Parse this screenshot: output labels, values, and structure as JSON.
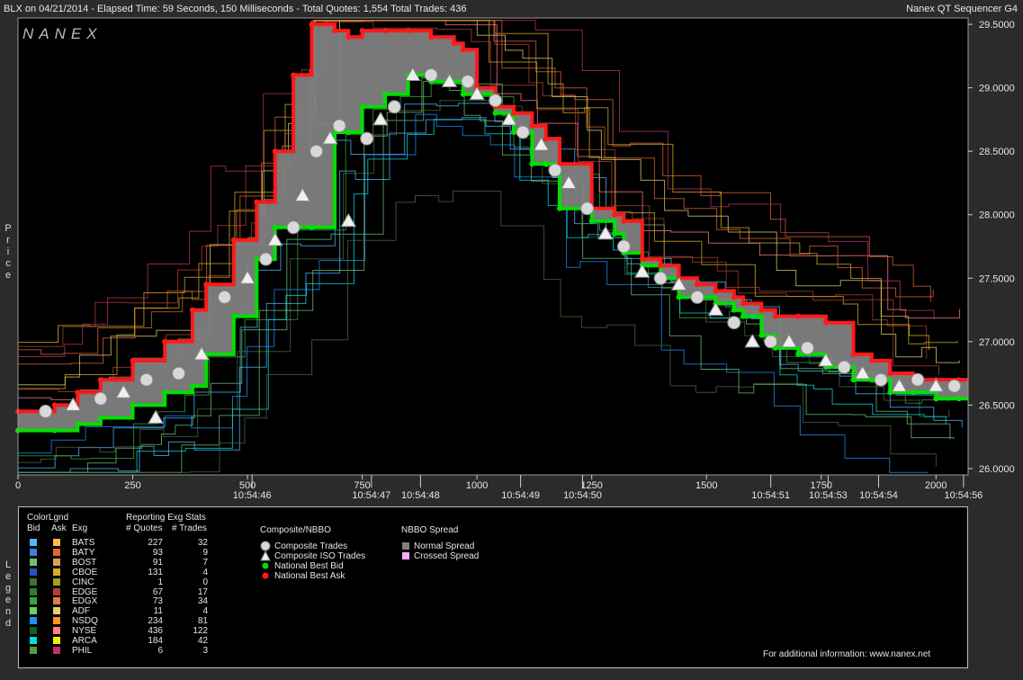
{
  "header": {
    "title_left": "BLX on 04/21/2014  -  Elapsed Time: 59 Seconds, 150 Milliseconds  -  Total Quotes: 1,554  Total Trades: 436",
    "title_right": "Nanex QT Sequencer G4",
    "logo": "NANEX",
    "price_axis_label": "Price",
    "legend_side_label": "Legend"
  },
  "colors": {
    "background": "#000000",
    "frame": "#2b2b2b",
    "spread": "#808080",
    "bid": "#00e000",
    "ask": "#ff1a1a",
    "trade_marker": "#d8d8d8"
  },
  "chart_data": {
    "type": "line",
    "title": "",
    "ylim": [
      25.95,
      29.55
    ],
    "xlim": [
      0,
      2070
    ],
    "y_ticks": [
      "29.5000",
      "29.0000",
      "28.5000",
      "28.0000",
      "27.5000",
      "27.0000",
      "26.5000",
      "26.0000"
    ],
    "y_tick_values": [
      29.5,
      29.0,
      28.5,
      28.0,
      27.5,
      27.0,
      26.5,
      26.0
    ],
    "x_ticks": [
      "0",
      "250",
      "500",
      "750",
      "1000",
      "1250",
      "1500",
      "1750",
      "2000"
    ],
    "x_tick_values": [
      0,
      250,
      500,
      750,
      1000,
      1250,
      1500,
      1750,
      2000
    ],
    "time_labels": [
      {
        "x": 510,
        "label": "10:54:46"
      },
      {
        "x": 770,
        "label": "10:54:47"
      },
      {
        "x": 877,
        "label": "10:54:48"
      },
      {
        "x": 1095,
        "label": "10:54:49"
      },
      {
        "x": 1230,
        "label": "10:54:50"
      },
      {
        "x": 1640,
        "label": "10:54:51"
      },
      {
        "x": 1765,
        "label": "10:54:53"
      },
      {
        "x": 1875,
        "label": "10:54:54"
      },
      {
        "x": 2060,
        "label": "10:54:56"
      }
    ],
    "series": [
      {
        "name": "National Best Bid",
        "color": "#00e000",
        "x": [
          0,
          80,
          130,
          180,
          250,
          320,
          380,
          410,
          470,
          520,
          560,
          600,
          640,
          690,
          720,
          750,
          800,
          850,
          900,
          950,
          970,
          1000,
          1040,
          1080,
          1120,
          1150,
          1180,
          1250,
          1300,
          1320,
          1360,
          1400,
          1440,
          1480,
          1520,
          1560,
          1580,
          1620,
          1650,
          1700,
          1760,
          1820,
          1860,
          1900,
          1950,
          2000,
          2050
        ],
        "y": [
          26.3,
          26.3,
          26.35,
          26.4,
          26.5,
          26.6,
          26.65,
          26.9,
          27.2,
          27.65,
          27.9,
          27.9,
          27.9,
          28.65,
          28.65,
          28.85,
          28.95,
          29.1,
          29.05,
          29.05,
          28.95,
          28.95,
          28.8,
          28.65,
          28.4,
          28.4,
          28.05,
          27.95,
          27.85,
          27.7,
          27.6,
          27.5,
          27.35,
          27.35,
          27.3,
          27.25,
          27.2,
          27.05,
          26.95,
          26.9,
          26.8,
          26.7,
          26.7,
          26.6,
          26.6,
          26.55,
          26.55
        ]
      },
      {
        "name": "National Best Ask",
        "color": "#ff1a1a",
        "x": [
          0,
          80,
          130,
          180,
          250,
          320,
          380,
          410,
          470,
          520,
          560,
          600,
          640,
          690,
          720,
          750,
          800,
          850,
          900,
          950,
          970,
          1000,
          1040,
          1080,
          1120,
          1150,
          1180,
          1250,
          1300,
          1320,
          1360,
          1400,
          1440,
          1480,
          1520,
          1560,
          1580,
          1620,
          1650,
          1700,
          1760,
          1820,
          1860,
          1900,
          1950,
          2000,
          2050
        ],
        "y": [
          26.45,
          26.5,
          26.6,
          26.7,
          26.85,
          27.0,
          27.25,
          27.45,
          27.8,
          28.1,
          28.5,
          29.1,
          29.5,
          29.45,
          29.4,
          29.45,
          29.45,
          29.45,
          29.4,
          29.35,
          29.3,
          29.0,
          28.85,
          28.8,
          28.7,
          28.6,
          28.4,
          28.05,
          28.0,
          27.95,
          27.65,
          27.6,
          27.5,
          27.45,
          27.4,
          27.35,
          27.3,
          27.25,
          27.2,
          27.2,
          27.15,
          26.9,
          26.85,
          26.75,
          26.7,
          26.7,
          26.7
        ]
      },
      {
        "name": "Composite Trades",
        "color": "#d8d8d8",
        "x": [
          60,
          120,
          180,
          230,
          280,
          300,
          350,
          400,
          450,
          500,
          540,
          560,
          600,
          620,
          650,
          680,
          700,
          720,
          760,
          790,
          820,
          860,
          900,
          940,
          980,
          1000,
          1040,
          1070,
          1100,
          1140,
          1170,
          1200,
          1240,
          1280,
          1320,
          1360,
          1400,
          1440,
          1480,
          1520,
          1560,
          1600,
          1640,
          1680,
          1720,
          1760,
          1800,
          1840,
          1880,
          1920,
          1960,
          2000,
          2040
        ],
        "y": [
          26.45,
          26.5,
          26.55,
          26.6,
          26.7,
          26.4,
          26.75,
          26.9,
          27.35,
          27.5,
          27.65,
          27.8,
          27.9,
          28.15,
          28.5,
          28.6,
          28.7,
          27.95,
          28.6,
          28.75,
          28.85,
          29.1,
          29.1,
          29.05,
          29.05,
          28.95,
          28.9,
          28.75,
          28.65,
          28.55,
          28.35,
          28.25,
          28.05,
          27.85,
          27.75,
          27.55,
          27.5,
          27.45,
          27.35,
          27.25,
          27.15,
          27.0,
          27.0,
          27.0,
          26.95,
          26.85,
          26.8,
          26.75,
          26.7,
          26.65,
          26.7,
          26.65,
          26.65
        ]
      }
    ]
  },
  "legend": {
    "headers": {
      "colorlgnd": "ColorLgnd",
      "bid": "Bid",
      "ask": "Ask",
      "exg": "Exg",
      "reporting": "Reporting Exg Stats",
      "quotes": "# Quotes",
      "trades": "# Trades"
    },
    "exchanges": [
      {
        "name": "BATS",
        "bid_color": "#4db8ff",
        "ask_color": "#ffb84d",
        "quotes": "227",
        "trades": "32"
      },
      {
        "name": "BATY",
        "bid_color": "#3d7fd9",
        "ask_color": "#e06633",
        "quotes": "93",
        "trades": "9"
      },
      {
        "name": "BOST",
        "bid_color": "#70c070",
        "ask_color": "#d9a05a",
        "quotes": "91",
        "trades": "7"
      },
      {
        "name": "CBOE",
        "bid_color": "#2850c8",
        "ask_color": "#d4b020",
        "quotes": "131",
        "trades": "4"
      },
      {
        "name": "CINC",
        "bid_color": "#4a6a3a",
        "ask_color": "#a0a020",
        "quotes": "1",
        "trades": "0"
      },
      {
        "name": "EDGE",
        "bid_color": "#2e7d2e",
        "ask_color": "#b04030",
        "quotes": "67",
        "trades": "17"
      },
      {
        "name": "EDGX",
        "bid_color": "#3ea03e",
        "ask_color": "#e07a40",
        "quotes": "73",
        "trades": "34"
      },
      {
        "name": "ADF",
        "bid_color": "#6ad06a",
        "ask_color": "#e0d070",
        "quotes": "11",
        "trades": "4"
      },
      {
        "name": "NSDQ",
        "bid_color": "#1e90ff",
        "ask_color": "#ff9020",
        "quotes": "234",
        "trades": "81"
      },
      {
        "name": "NYSE",
        "bid_color": "#1a5c1a",
        "ask_color": "#ff8080",
        "quotes": "436",
        "trades": "122"
      },
      {
        "name": "ARCA",
        "bid_color": "#00e0e0",
        "ask_color": "#f0f000",
        "quotes": "184",
        "trades": "42"
      },
      {
        "name": "PHIL",
        "bid_color": "#5a9a3a",
        "ask_color": "#c03070",
        "quotes": "6",
        "trades": "3"
      }
    ],
    "composite": {
      "title": "Composite/NBBO",
      "items": [
        "Composite Trades",
        "Composite ISO Trades",
        "National Best Bid",
        "National Best Ask"
      ]
    },
    "spread": {
      "title": "NBBO Spread",
      "items": [
        {
          "label": "Normal Spread",
          "color": "#808080"
        },
        {
          "label": "Crossed Spread",
          "color": "#ffaaff"
        }
      ]
    },
    "footer": "For additional information: www.nanex.net"
  }
}
